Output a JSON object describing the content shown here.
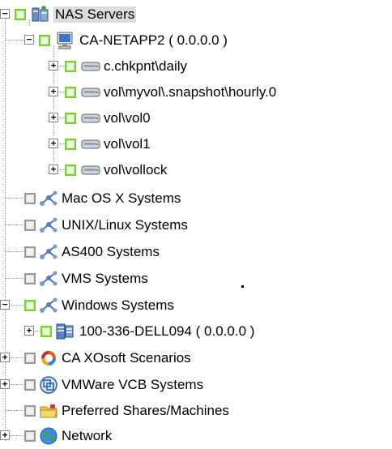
{
  "tree": {
    "nas_servers": "NAS Servers",
    "ca_netapp2": "CA-NETAPP2 ( 0.0.0.0 )",
    "volumes": [
      "c.chkpnt\\daily",
      "vol\\myvol\\.snapshot\\hourly.0",
      "vol\\vol0",
      "vol\\vol1",
      "vol\\vollock"
    ],
    "mac_os_x": "Mac OS X Systems",
    "unix_linux": "UNIX/Linux Systems",
    "as400": "AS400 Systems",
    "vms": "VMS Systems",
    "windows": "Windows Systems",
    "dell_host": "100-336-DELL094 ( 0.0.0.0 )",
    "xosoft": "CA XOsoft Scenarios",
    "vmware_vcb": "VMWare VCB Systems",
    "preferred_shares": "Preferred Shares/Machines",
    "network": "Network"
  },
  "colors": {
    "check_green": "#7ccc3c",
    "check_gray": "#999999",
    "selection": "#dcdcdc"
  }
}
